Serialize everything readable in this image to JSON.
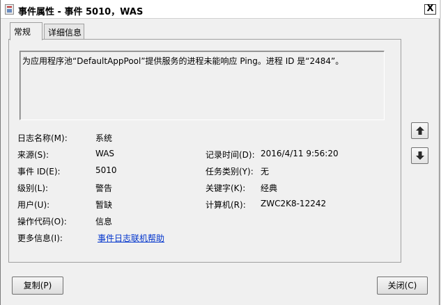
{
  "window": {
    "title": "事件属性 - 事件 5010，WAS",
    "close_glyph": "X"
  },
  "tabs": [
    {
      "label": "常规",
      "active": true
    },
    {
      "label": "详细信息",
      "active": false
    }
  ],
  "description": "为应用程序池“DefaultAppPool”提供服务的进程未能响应 Ping。进程 ID 是“2484”。",
  "fields_left": [
    {
      "label": "日志名称(M):",
      "value": "系统"
    },
    {
      "label": "来源(S):",
      "value": "WAS"
    },
    {
      "label": "事件 ID(E):",
      "value": "5010"
    },
    {
      "label": "级别(L):",
      "value": "警告"
    },
    {
      "label": "用户(U):",
      "value": "暂缺"
    },
    {
      "label": "操作代码(O):",
      "value": "信息"
    },
    {
      "label": "更多信息(I):",
      "value": "事件日志联机帮助"
    }
  ],
  "fields_right": [
    {
      "label": "记录时间(D):",
      "value": "2016/4/11 9:56:20"
    },
    {
      "label": "任务类别(Y):",
      "value": "无"
    },
    {
      "label": "关键字(K):",
      "value": "经典"
    },
    {
      "label": "计算机(R):",
      "value": "ZWC2K8-12242"
    }
  ],
  "nav": {
    "up_icon": "up-arrow-icon",
    "down_icon": "down-arrow-icon"
  },
  "buttons": {
    "copy": "复制(P)",
    "close": "关闭(C)"
  }
}
